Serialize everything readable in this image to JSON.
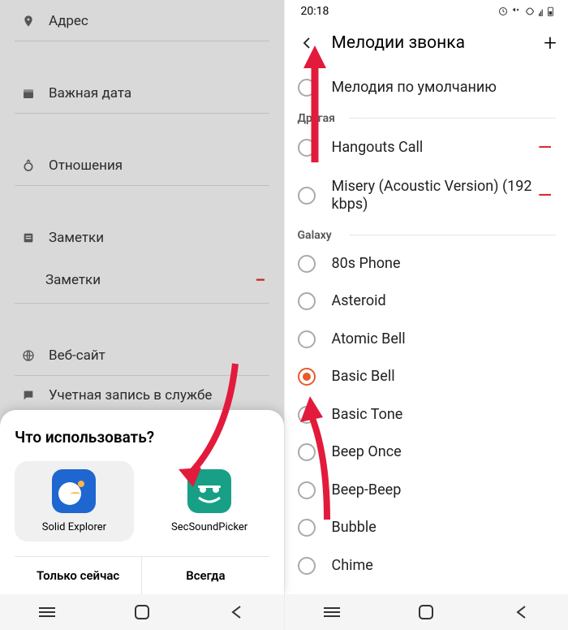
{
  "left": {
    "fields": [
      {
        "icon": "pin",
        "label": "Адрес"
      },
      {
        "icon": "cal",
        "label": "Важная дата"
      },
      {
        "icon": "ring",
        "label": "Отношения"
      },
      {
        "icon": "note",
        "label": "Заметки"
      },
      {
        "icon": "",
        "label": "Заметки",
        "sub": true,
        "minus": true
      },
      {
        "icon": "globe",
        "label": "Веб-сайт"
      },
      {
        "icon": "chat",
        "label": "Учетная запись в службе"
      }
    ],
    "sheet": {
      "title": "Что использовать?",
      "apps": [
        {
          "name": "Solid Explorer",
          "selected": true
        },
        {
          "name": "SecSoundPicker",
          "selected": false
        }
      ],
      "action_once": "Только сейчас",
      "action_always": "Всегда"
    }
  },
  "right": {
    "time": "20:18",
    "title": "Мелодии звонка",
    "default_label": "Мелодия по умолчанию",
    "section_other": "Другая",
    "section_galaxy": "Galaxy",
    "other_items": [
      {
        "label": "Hangouts Call",
        "deletable": true
      },
      {
        "label": "Misery (Acoustic Version) (192  kbps)",
        "deletable": true
      }
    ],
    "galaxy_items": [
      {
        "label": "80s Phone"
      },
      {
        "label": "Asteroid"
      },
      {
        "label": "Atomic Bell"
      },
      {
        "label": "Basic Bell",
        "checked": true
      },
      {
        "label": "Basic Tone"
      },
      {
        "label": "Beep Once"
      },
      {
        "label": "Beep-Beep"
      },
      {
        "label": "Bubble"
      },
      {
        "label": "Chime"
      }
    ]
  }
}
